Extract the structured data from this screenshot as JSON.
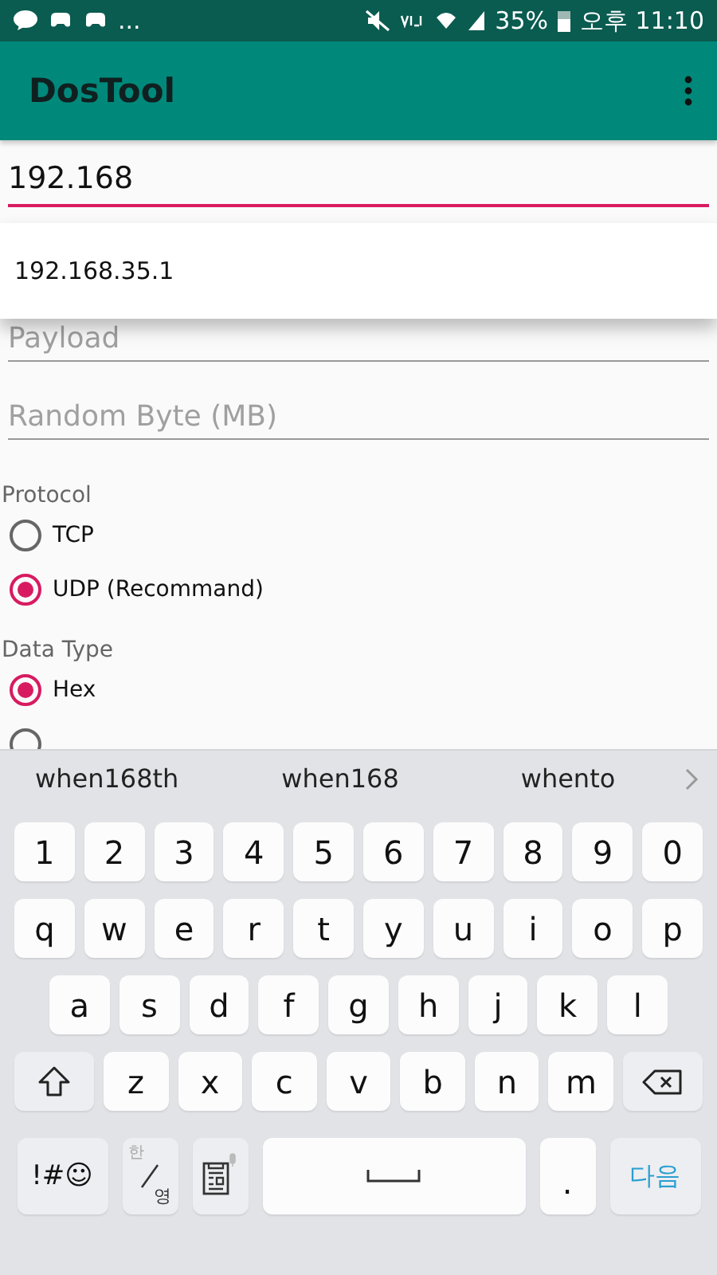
{
  "status_bar": {
    "more": "...",
    "battery": "35%",
    "time": "오후 11:10"
  },
  "app_bar": {
    "title": "DosTool"
  },
  "host_field": {
    "value": "192.168"
  },
  "suggestions_dropdown": {
    "items": [
      "192.168.35.1"
    ]
  },
  "payload_field": {
    "placeholder": "Payload"
  },
  "random_byte_field": {
    "placeholder": "Random Byte (MB)"
  },
  "protocol": {
    "label": "Protocol",
    "options": [
      {
        "label": "TCP",
        "selected": false
      },
      {
        "label": "UDP (Recommand)",
        "selected": true
      }
    ]
  },
  "data_type": {
    "label": "Data Type",
    "options": [
      {
        "label": "Hex",
        "selected": true
      },
      {
        "selected": false
      }
    ]
  },
  "keyboard": {
    "predictions": [
      "when168th",
      "when168",
      "whento"
    ],
    "rows": [
      {
        "keys": [
          {
            "kind": "char",
            "label": "1"
          },
          {
            "kind": "char",
            "label": "2"
          },
          {
            "kind": "char",
            "label": "3"
          },
          {
            "kind": "char",
            "label": "4"
          },
          {
            "kind": "char",
            "label": "5"
          },
          {
            "kind": "char",
            "label": "6"
          },
          {
            "kind": "char",
            "label": "7"
          },
          {
            "kind": "char",
            "label": "8"
          },
          {
            "kind": "char",
            "label": "9"
          },
          {
            "kind": "char",
            "label": "0"
          }
        ]
      },
      {
        "keys": [
          {
            "kind": "char",
            "label": "q"
          },
          {
            "kind": "char",
            "label": "w"
          },
          {
            "kind": "char",
            "label": "e"
          },
          {
            "kind": "char",
            "label": "r"
          },
          {
            "kind": "char",
            "label": "t"
          },
          {
            "kind": "char",
            "label": "y"
          },
          {
            "kind": "char",
            "label": "u"
          },
          {
            "kind": "char",
            "label": "i"
          },
          {
            "kind": "char",
            "label": "o"
          },
          {
            "kind": "char",
            "label": "p"
          }
        ]
      },
      {
        "keys": [
          {
            "kind": "char",
            "label": "a"
          },
          {
            "kind": "char",
            "label": "s"
          },
          {
            "kind": "char",
            "label": "d"
          },
          {
            "kind": "char",
            "label": "f"
          },
          {
            "kind": "char",
            "label": "g"
          },
          {
            "kind": "char",
            "label": "h"
          },
          {
            "kind": "char",
            "label": "j"
          },
          {
            "kind": "char",
            "label": "k"
          },
          {
            "kind": "char",
            "label": "l"
          }
        ]
      },
      {
        "keys": [
          {
            "kind": "shift"
          },
          {
            "kind": "char",
            "label": "z"
          },
          {
            "kind": "char",
            "label": "x"
          },
          {
            "kind": "char",
            "label": "c"
          },
          {
            "kind": "char",
            "label": "v"
          },
          {
            "kind": "char",
            "label": "b"
          },
          {
            "kind": "char",
            "label": "n"
          },
          {
            "kind": "char",
            "label": "m"
          },
          {
            "kind": "backspace"
          }
        ]
      },
      {
        "keys": [
          {
            "kind": "symbols",
            "label": "!#☺"
          },
          {
            "kind": "lang",
            "primary": "한",
            "secondary": "영"
          },
          {
            "kind": "clipboard"
          },
          {
            "kind": "space"
          },
          {
            "kind": "char",
            "label": "."
          },
          {
            "kind": "action",
            "label": "다음"
          }
        ]
      }
    ]
  }
}
